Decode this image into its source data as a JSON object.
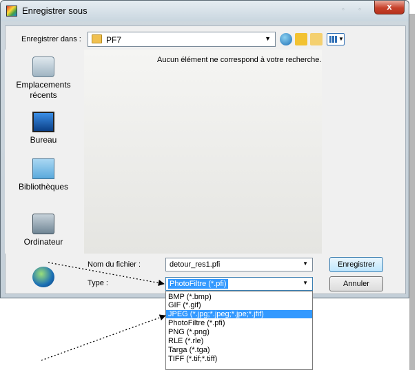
{
  "window": {
    "title": "Enregistrer sous",
    "close_label": "x"
  },
  "toolbar": {
    "save_in_label": "Enregistrer dans :",
    "save_in_value": "PF7"
  },
  "places": [
    {
      "label": "Emplacements récents"
    },
    {
      "label": "Bureau"
    },
    {
      "label": "Bibliothèques"
    },
    {
      "label": "Ordinateur"
    },
    {
      "label": ""
    }
  ],
  "filelist": {
    "empty_message": "Aucun élément ne correspond à votre recherche."
  },
  "filename": {
    "label": "Nom du fichier :",
    "value": "detour_res1.pfi"
  },
  "filetype": {
    "label": "Type :",
    "value": "PhotoFiltre (*.pfi)",
    "options": [
      "BMP (*.bmp)",
      "GIF (*.gif)",
      "JPEG (*.jpg;*.jpeg;*.jpe;*.jfif)",
      "PhotoFiltre (*.pfi)",
      "PNG (*.png)",
      "RLE (*.rle)",
      "Targa (*.tga)",
      "TIFF (*.tif;*.tiff)"
    ],
    "highlighted_index": 2
  },
  "buttons": {
    "save_label": "Enregistrer",
    "cancel_label": "Annuler"
  },
  "colors": {
    "selection": "#3399ff",
    "close": "#c7412b"
  }
}
